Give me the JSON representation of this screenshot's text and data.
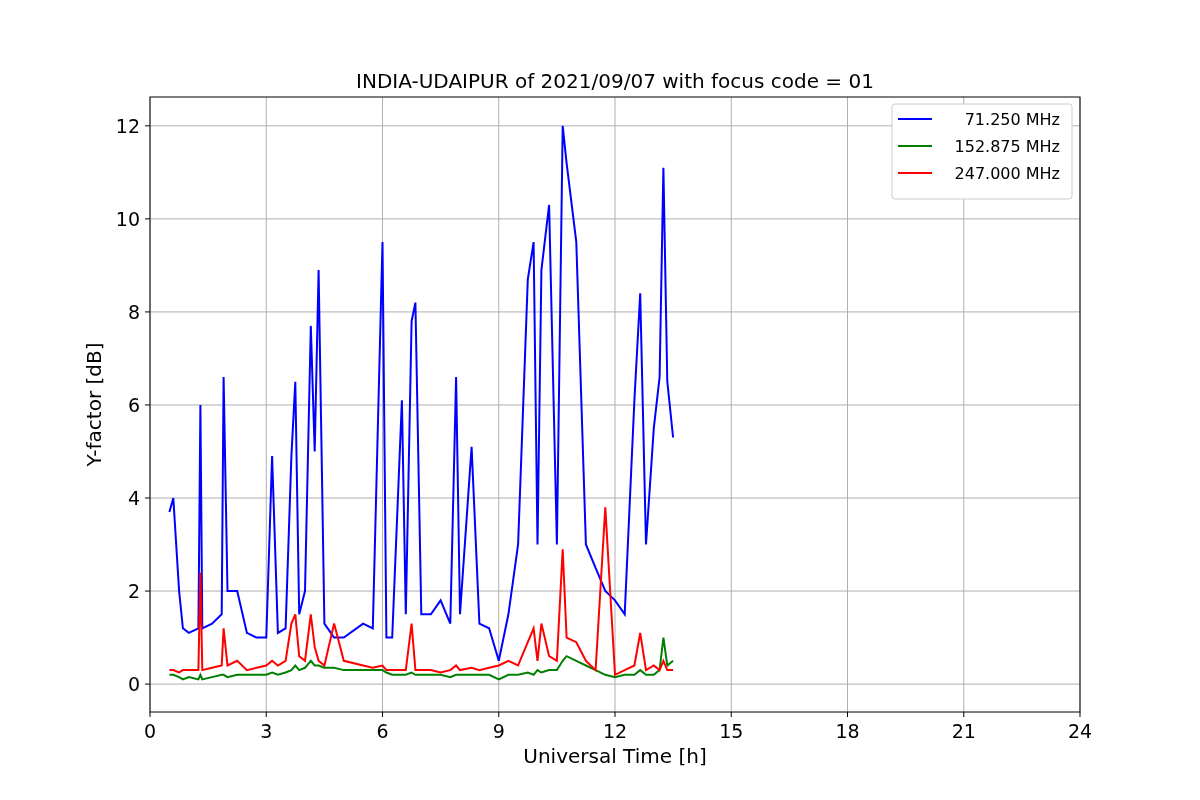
{
  "figure": {
    "chart_data": {
      "type": "line",
      "title": "INDIA-UDAIPUR of 2021/09/07 with focus code = 01",
      "xlabel": "Universal Time [h]",
      "ylabel": "Y-factor [dB]",
      "grid": true,
      "legend": true,
      "xlim": [
        0,
        24
      ],
      "ylim": [
        -0.6,
        12.62
      ],
      "xticks": [
        0,
        3,
        6,
        9,
        12,
        15,
        18,
        21,
        24
      ],
      "yticks": [
        0,
        2,
        4,
        6,
        8,
        10,
        12
      ],
      "x": [
        0.5,
        0.6,
        0.75,
        0.85,
        1.0,
        1.25,
        1.3,
        1.35,
        1.6,
        1.85,
        1.9,
        2.0,
        2.25,
        2.5,
        2.75,
        3.0,
        3.15,
        3.3,
        3.5,
        3.65,
        3.75,
        3.85,
        4.0,
        4.15,
        4.25,
        4.35,
        4.5,
        4.75,
        5.0,
        5.5,
        5.75,
        6.0,
        6.1,
        6.25,
        6.5,
        6.6,
        6.75,
        6.85,
        7.0,
        7.25,
        7.5,
        7.75,
        7.9,
        8.0,
        8.3,
        8.5,
        8.75,
        9.0,
        9.25,
        9.5,
        9.75,
        9.9,
        10.0,
        10.1,
        10.3,
        10.5,
        10.65,
        10.75,
        11.0,
        11.25,
        11.5,
        11.75,
        12.0,
        12.25,
        12.5,
        12.65,
        12.8,
        13.0,
        13.15,
        13.25,
        13.35,
        13.5
      ],
      "series": [
        {
          "name": "71.250 MHz",
          "color": "#0000ff",
          "values": [
            3.7,
            4.0,
            2.0,
            1.2,
            1.1,
            1.2,
            6.0,
            1.2,
            1.3,
            1.5,
            6.6,
            2.0,
            2.0,
            1.1,
            1.0,
            1.0,
            4.9,
            1.1,
            1.2,
            4.9,
            6.5,
            1.5,
            2.0,
            7.7,
            5.0,
            8.9,
            1.3,
            1.0,
            1.0,
            1.3,
            1.2,
            9.5,
            1.0,
            1.0,
            6.1,
            1.5,
            7.8,
            8.2,
            1.5,
            1.5,
            1.8,
            1.3,
            6.6,
            1.5,
            5.1,
            1.3,
            1.2,
            0.5,
            1.5,
            3.0,
            8.7,
            9.5,
            3.0,
            8.9,
            10.3,
            3.0,
            12.0,
            11.2,
            9.5,
            3.0,
            2.5,
            2.0,
            1.8,
            1.5,
            6.1,
            8.4,
            3.0,
            5.5,
            6.6,
            11.1,
            6.5,
            5.3
          ]
        },
        {
          "name": "152.875 MHz",
          "color": "#008000",
          "values": [
            0.2,
            0.2,
            0.15,
            0.1,
            0.15,
            0.1,
            0.2,
            0.1,
            0.15,
            0.2,
            0.2,
            0.15,
            0.2,
            0.2,
            0.2,
            0.2,
            0.25,
            0.2,
            0.25,
            0.3,
            0.4,
            0.3,
            0.35,
            0.5,
            0.4,
            0.4,
            0.35,
            0.35,
            0.3,
            0.3,
            0.3,
            0.3,
            0.25,
            0.2,
            0.2,
            0.2,
            0.25,
            0.2,
            0.2,
            0.2,
            0.2,
            0.15,
            0.2,
            0.2,
            0.2,
            0.2,
            0.2,
            0.1,
            0.2,
            0.2,
            0.25,
            0.2,
            0.3,
            0.25,
            0.3,
            0.3,
            0.5,
            0.6,
            0.5,
            0.4,
            0.3,
            0.2,
            0.15,
            0.2,
            0.2,
            0.3,
            0.2,
            0.2,
            0.3,
            1.0,
            0.4,
            0.5
          ]
        },
        {
          "name": "247.000 MHz",
          "color": "#ff0000",
          "values": [
            0.3,
            0.3,
            0.25,
            0.3,
            0.3,
            0.3,
            2.4,
            0.3,
            0.35,
            0.4,
            1.2,
            0.4,
            0.5,
            0.3,
            0.35,
            0.4,
            0.5,
            0.4,
            0.5,
            1.3,
            1.5,
            0.6,
            0.5,
            1.5,
            0.8,
            0.5,
            0.4,
            1.3,
            0.5,
            0.4,
            0.35,
            0.4,
            0.3,
            0.3,
            0.3,
            0.3,
            1.3,
            0.3,
            0.3,
            0.3,
            0.25,
            0.3,
            0.4,
            0.3,
            0.35,
            0.3,
            0.35,
            0.4,
            0.5,
            0.4,
            0.9,
            1.2,
            0.5,
            1.3,
            0.6,
            0.5,
            2.9,
            1.0,
            0.9,
            0.5,
            0.3,
            3.8,
            0.2,
            0.3,
            0.4,
            1.1,
            0.3,
            0.4,
            0.3,
            0.5,
            0.3,
            0.3
          ]
        }
      ]
    }
  }
}
